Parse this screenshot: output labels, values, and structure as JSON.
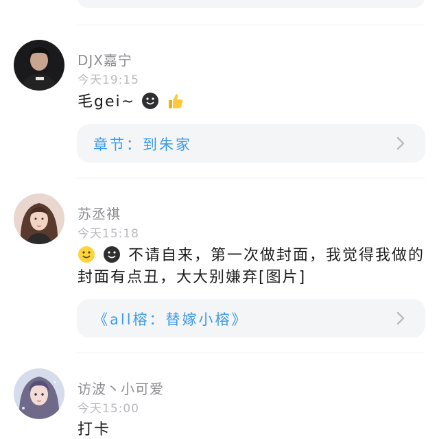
{
  "comments": [
    {
      "username": "DJX嘉宁",
      "timestamp": "今天19:15",
      "text": "毛gei~",
      "emojis": [
        "dark-smiley-icon",
        "thumbs-up-icon"
      ],
      "link_label": "章节：到朱家"
    },
    {
      "username": "苏丞祺",
      "timestamp": "今天15:18",
      "text": "不请自来，第一次做封面，我觉得我做的封面有点丑，大大别嫌弃[图片]",
      "emojis": [
        "smiley-icon",
        "dark-smiley-icon"
      ],
      "link_label": "《all榕：替嫁小榕》"
    },
    {
      "username": "访波丶小可爱",
      "timestamp": "今天15:00",
      "text": "打卡"
    }
  ],
  "colors": {
    "link": "#3d9be9",
    "card_bg": "#f4f5f7",
    "username": "#8e8e93",
    "timestamp": "#b7b9bd"
  }
}
